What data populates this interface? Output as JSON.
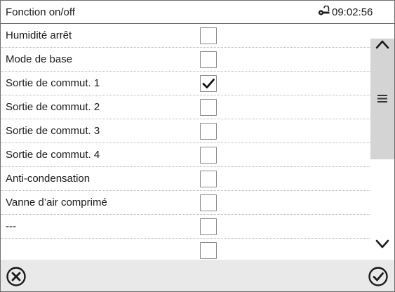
{
  "header": {
    "title": "Fonction on/off",
    "time": "09:02:56",
    "lock_icon": "lock-icon"
  },
  "rows": [
    {
      "label": "Humidité arrêt",
      "checked": false
    },
    {
      "label": "Mode de base",
      "checked": false
    },
    {
      "label": "Sortie de commut. 1",
      "checked": true
    },
    {
      "label": "Sortie de commut. 2",
      "checked": false
    },
    {
      "label": "Sortie de commut. 3",
      "checked": false
    },
    {
      "label": "Sortie de commut. 4",
      "checked": false
    },
    {
      "label": "Anti-condensation",
      "checked": false
    },
    {
      "label": "Vanne d’air comprimé",
      "checked": false
    },
    {
      "label": "---",
      "checked": false
    },
    {
      "label": "",
      "checked": false
    }
  ],
  "scrollbar": {
    "up_icon": "chevron-up-icon",
    "down_icon": "chevron-down-icon",
    "handle_icon": "menu-handle-icon"
  },
  "footer": {
    "cancel_icon": "cancel-circle-icon",
    "confirm_icon": "confirm-circle-icon"
  },
  "colors": {
    "footer_bg": "#e9e9e9",
    "scroll_thumb": "#d4d4d4",
    "border": "#6e6e6e"
  }
}
